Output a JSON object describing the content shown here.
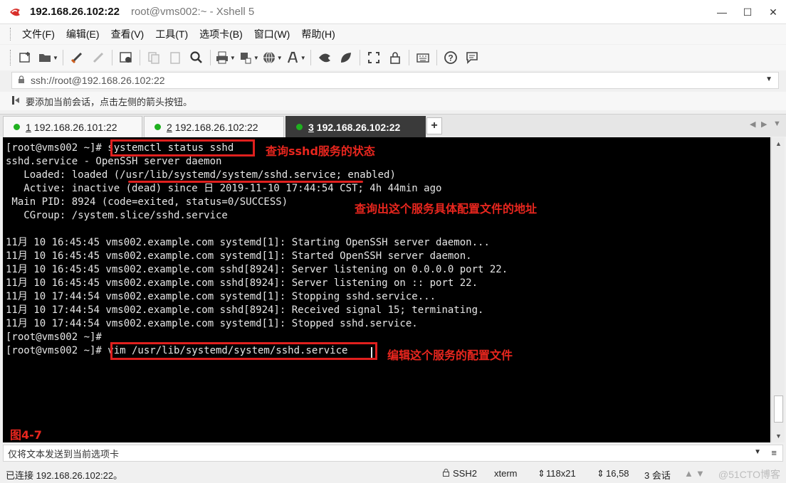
{
  "window": {
    "title_host": "192.168.26.102:22",
    "title_rest": "root@vms002:~ - Xshell 5",
    "minimize_glyph": "—",
    "maximize_glyph": "☐",
    "close_glyph": "✕"
  },
  "menu": [
    "文件(F)",
    "编辑(E)",
    "查看(V)",
    "工具(T)",
    "选项卡(B)",
    "窗口(W)",
    "帮助(H)"
  ],
  "address": {
    "text": "ssh://root@192.168.26.102:22"
  },
  "hint": {
    "text": "要添加当前会话，点击左侧的箭头按钮。"
  },
  "tabs": [
    {
      "num": "1",
      "label": " 192.168.26.101:22"
    },
    {
      "num": "2",
      "label": " 192.168.26.102:22"
    },
    {
      "num": "3",
      "label": " 192.168.26.102:22"
    }
  ],
  "tab_add": "+",
  "terminal": {
    "lines": [
      "[root@vms002 ~]# systemctl status sshd",
      "sshd.service - OpenSSH server daemon",
      "   Loaded: loaded (/usr/lib/systemd/system/sshd.service; enabled)",
      "   Active: inactive (dead) since 日 2019-11-10 17:44:54 CST; 4h 44min ago",
      " Main PID: 8924 (code=exited, status=0/SUCCESS)",
      "   CGroup: /system.slice/sshd.service",
      "",
      "11月 10 16:45:45 vms002.example.com systemd[1]: Starting OpenSSH server daemon...",
      "11月 10 16:45:45 vms002.example.com systemd[1]: Started OpenSSH server daemon.",
      "11月 10 16:45:45 vms002.example.com sshd[8924]: Server listening on 0.0.0.0 port 22.",
      "11月 10 16:45:45 vms002.example.com sshd[8924]: Server listening on :: port 22.",
      "11月 10 17:44:54 vms002.example.com systemd[1]: Stopping sshd.service...",
      "11月 10 17:44:54 vms002.example.com sshd[8924]: Received signal 15; terminating.",
      "11月 10 17:44:54 vms002.example.com systemd[1]: Stopped sshd.service.",
      "[root@vms002 ~]#",
      "[root@vms002 ~]# vim /usr/lib/systemd/system/sshd.service"
    ],
    "annotations": {
      "status_cmd": "查询sshd服务的状态",
      "config_path": "查询出这个服务具体配置文件的地址",
      "vim_cmd": "编辑这个服务的配置文件",
      "figure_label": "图4-7"
    }
  },
  "send_bar": {
    "text": "仅将文本发送到当前选项卡"
  },
  "status": {
    "connection": "已连接 192.168.26.102:22。",
    "protocol": "SSH2",
    "term_type": "xterm",
    "size": "118x21",
    "cursor_pos": "16,58",
    "sessions": "3 会话",
    "watermark": "@51CTO博客"
  },
  "colors": {
    "annotation_red": "#e0201e",
    "terminal_bg": "#000000",
    "active_tab": "#3a3a3a",
    "connected_dot": "#1fb01f"
  }
}
